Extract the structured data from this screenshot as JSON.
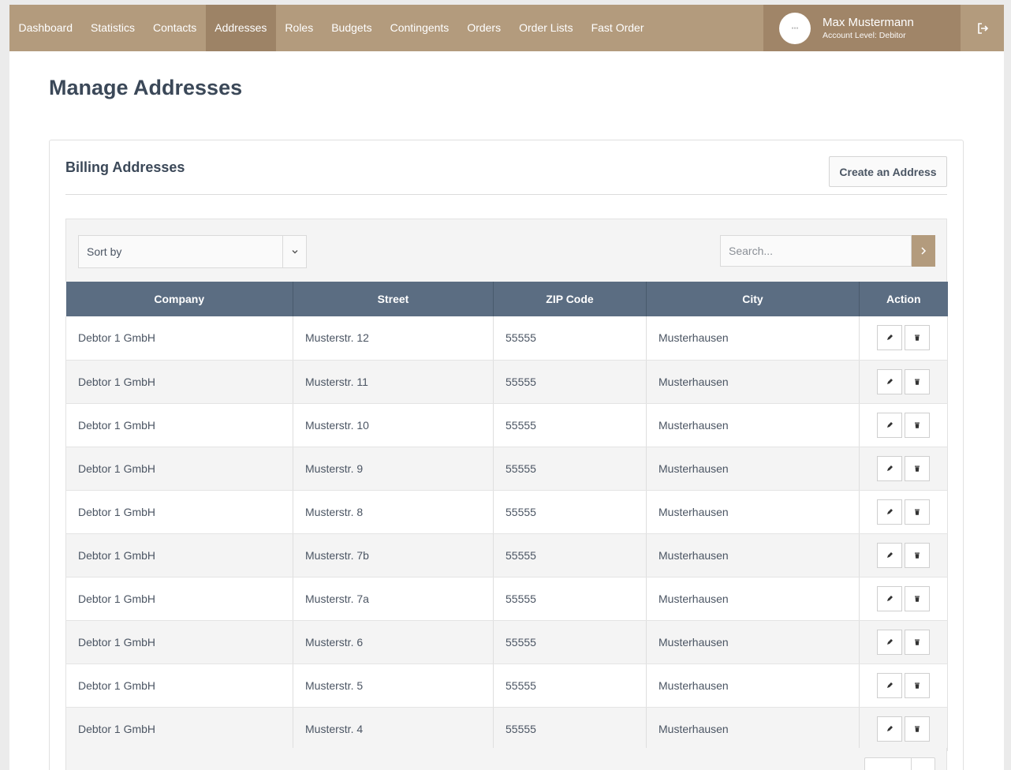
{
  "nav": {
    "items": [
      {
        "label": "Dashboard",
        "active": false
      },
      {
        "label": "Statistics",
        "active": false
      },
      {
        "label": "Contacts",
        "active": false
      },
      {
        "label": "Addresses",
        "active": true
      },
      {
        "label": "Roles",
        "active": false
      },
      {
        "label": "Budgets",
        "active": false
      },
      {
        "label": "Contingents",
        "active": false
      },
      {
        "label": "Orders",
        "active": false
      },
      {
        "label": "Order Lists",
        "active": false
      },
      {
        "label": "Fast Order",
        "active": false
      }
    ],
    "user": {
      "name": "Max Mustermann",
      "level": "Account Level: Debitor"
    },
    "logout_icon": "logout-icon"
  },
  "page": {
    "title": "Manage Addresses"
  },
  "card": {
    "title": "Billing Addresses",
    "create_label": "Create an Address"
  },
  "toolbar": {
    "sort_label": "Sort by",
    "search_placeholder": "Search..."
  },
  "table": {
    "columns": [
      "Company",
      "Street",
      "ZIP Code",
      "City",
      "Action"
    ],
    "rows": [
      {
        "company": "Debtor 1 GmbH",
        "street": "Musterstr. 12",
        "zip": "55555",
        "city": "Musterhausen"
      },
      {
        "company": "Debtor 1 GmbH",
        "street": "Musterstr. 11",
        "zip": "55555",
        "city": "Musterhausen"
      },
      {
        "company": "Debtor 1 GmbH",
        "street": "Musterstr. 10",
        "zip": "55555",
        "city": "Musterhausen"
      },
      {
        "company": "Debtor 1 GmbH",
        "street": "Musterstr. 9",
        "zip": "55555",
        "city": "Musterhausen"
      },
      {
        "company": "Debtor 1 GmbH",
        "street": "Musterstr. 8",
        "zip": "55555",
        "city": "Musterhausen"
      },
      {
        "company": "Debtor 1 GmbH",
        "street": "Musterstr. 7b",
        "zip": "55555",
        "city": "Musterhausen"
      },
      {
        "company": "Debtor 1 GmbH",
        "street": "Musterstr. 7a",
        "zip": "55555",
        "city": "Musterhausen"
      },
      {
        "company": "Debtor 1 GmbH",
        "street": "Musterstr. 6",
        "zip": "55555",
        "city": "Musterhausen"
      },
      {
        "company": "Debtor 1 GmbH",
        "street": "Musterstr. 5",
        "zip": "55555",
        "city": "Musterhausen"
      },
      {
        "company": "Debtor 1 GmbH",
        "street": "Musterstr. 4",
        "zip": "55555",
        "city": "Musterhausen"
      }
    ]
  },
  "colors": {
    "brand": "#b39b7d",
    "brand_dark": "#9d8366",
    "table_header": "#5b6d82"
  }
}
